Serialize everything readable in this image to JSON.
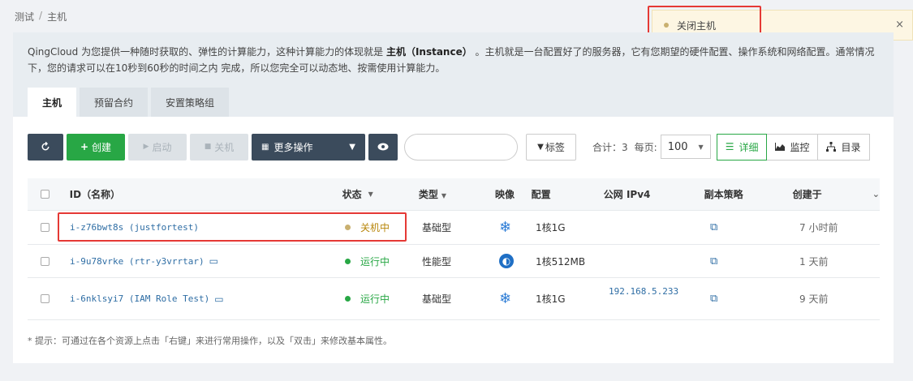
{
  "breadcrumb": {
    "root": "测试",
    "sep": "/",
    "current": "主机"
  },
  "toast": {
    "message": "关闭主机",
    "close": "×"
  },
  "intro": {
    "prefix": "QingCloud 为您提供一种随时获取的、弹性的计算能力，这种计算能力的体现就是",
    "bold": "主机（Instance）",
    "suffix": "。主机就是一台配置好了的服务器，它有您期望的硬件配置、操作系统和网络配置。通常情况下，您的请求可以在10秒到60秒的时间之内 完成，所以您完全可以动态地、按需使用计算能力。"
  },
  "tabs": [
    {
      "label": "主机"
    },
    {
      "label": "预留合约"
    },
    {
      "label": "安置策略组"
    }
  ],
  "toolbar": {
    "create": "创建",
    "start": "启动",
    "stop": "关机",
    "more": "更多操作",
    "tag": "标签",
    "total": "合计：3",
    "per_page": "每页:",
    "page_size": "100",
    "views": [
      {
        "label": "详细"
      },
      {
        "label": "监控"
      },
      {
        "label": "目录"
      }
    ]
  },
  "table": {
    "headers": {
      "id": "ID（名称）",
      "state": "状态",
      "type": "类型",
      "image": "映像",
      "config": "配置",
      "ip": "公网 IPv4",
      "replica": "副本策略",
      "created": "创建于"
    },
    "rows": [
      {
        "id": "i-z76bwt8s (justfortest)",
        "state": "关机中",
        "state_color": "#c9b070",
        "type": "基础型",
        "config": "1核1G",
        "ip": "",
        "created": "7 小时前"
      },
      {
        "id": "i-9u78vrke (rtr-y3vrrtar)",
        "state": "运行中",
        "state_color": "#28a745",
        "type": "性能型",
        "config": "1核512MB",
        "ip": "",
        "created": "1 天前"
      },
      {
        "id": "i-6nklsyi7 (IAM Role Test)",
        "state": "运行中",
        "state_color": "#28a745",
        "type": "基础型",
        "config": "1核1G",
        "ip": "192.168.5.233",
        "created": "9 天前"
      }
    ]
  },
  "footnote": "* 提示：可通过在各个资源上点击「右键」来进行常用操作，以及「双击」来修改基本属性。",
  "colors": {
    "accent": "#28a745",
    "dark": "#3b4b5c",
    "highlight": "#e53935"
  }
}
